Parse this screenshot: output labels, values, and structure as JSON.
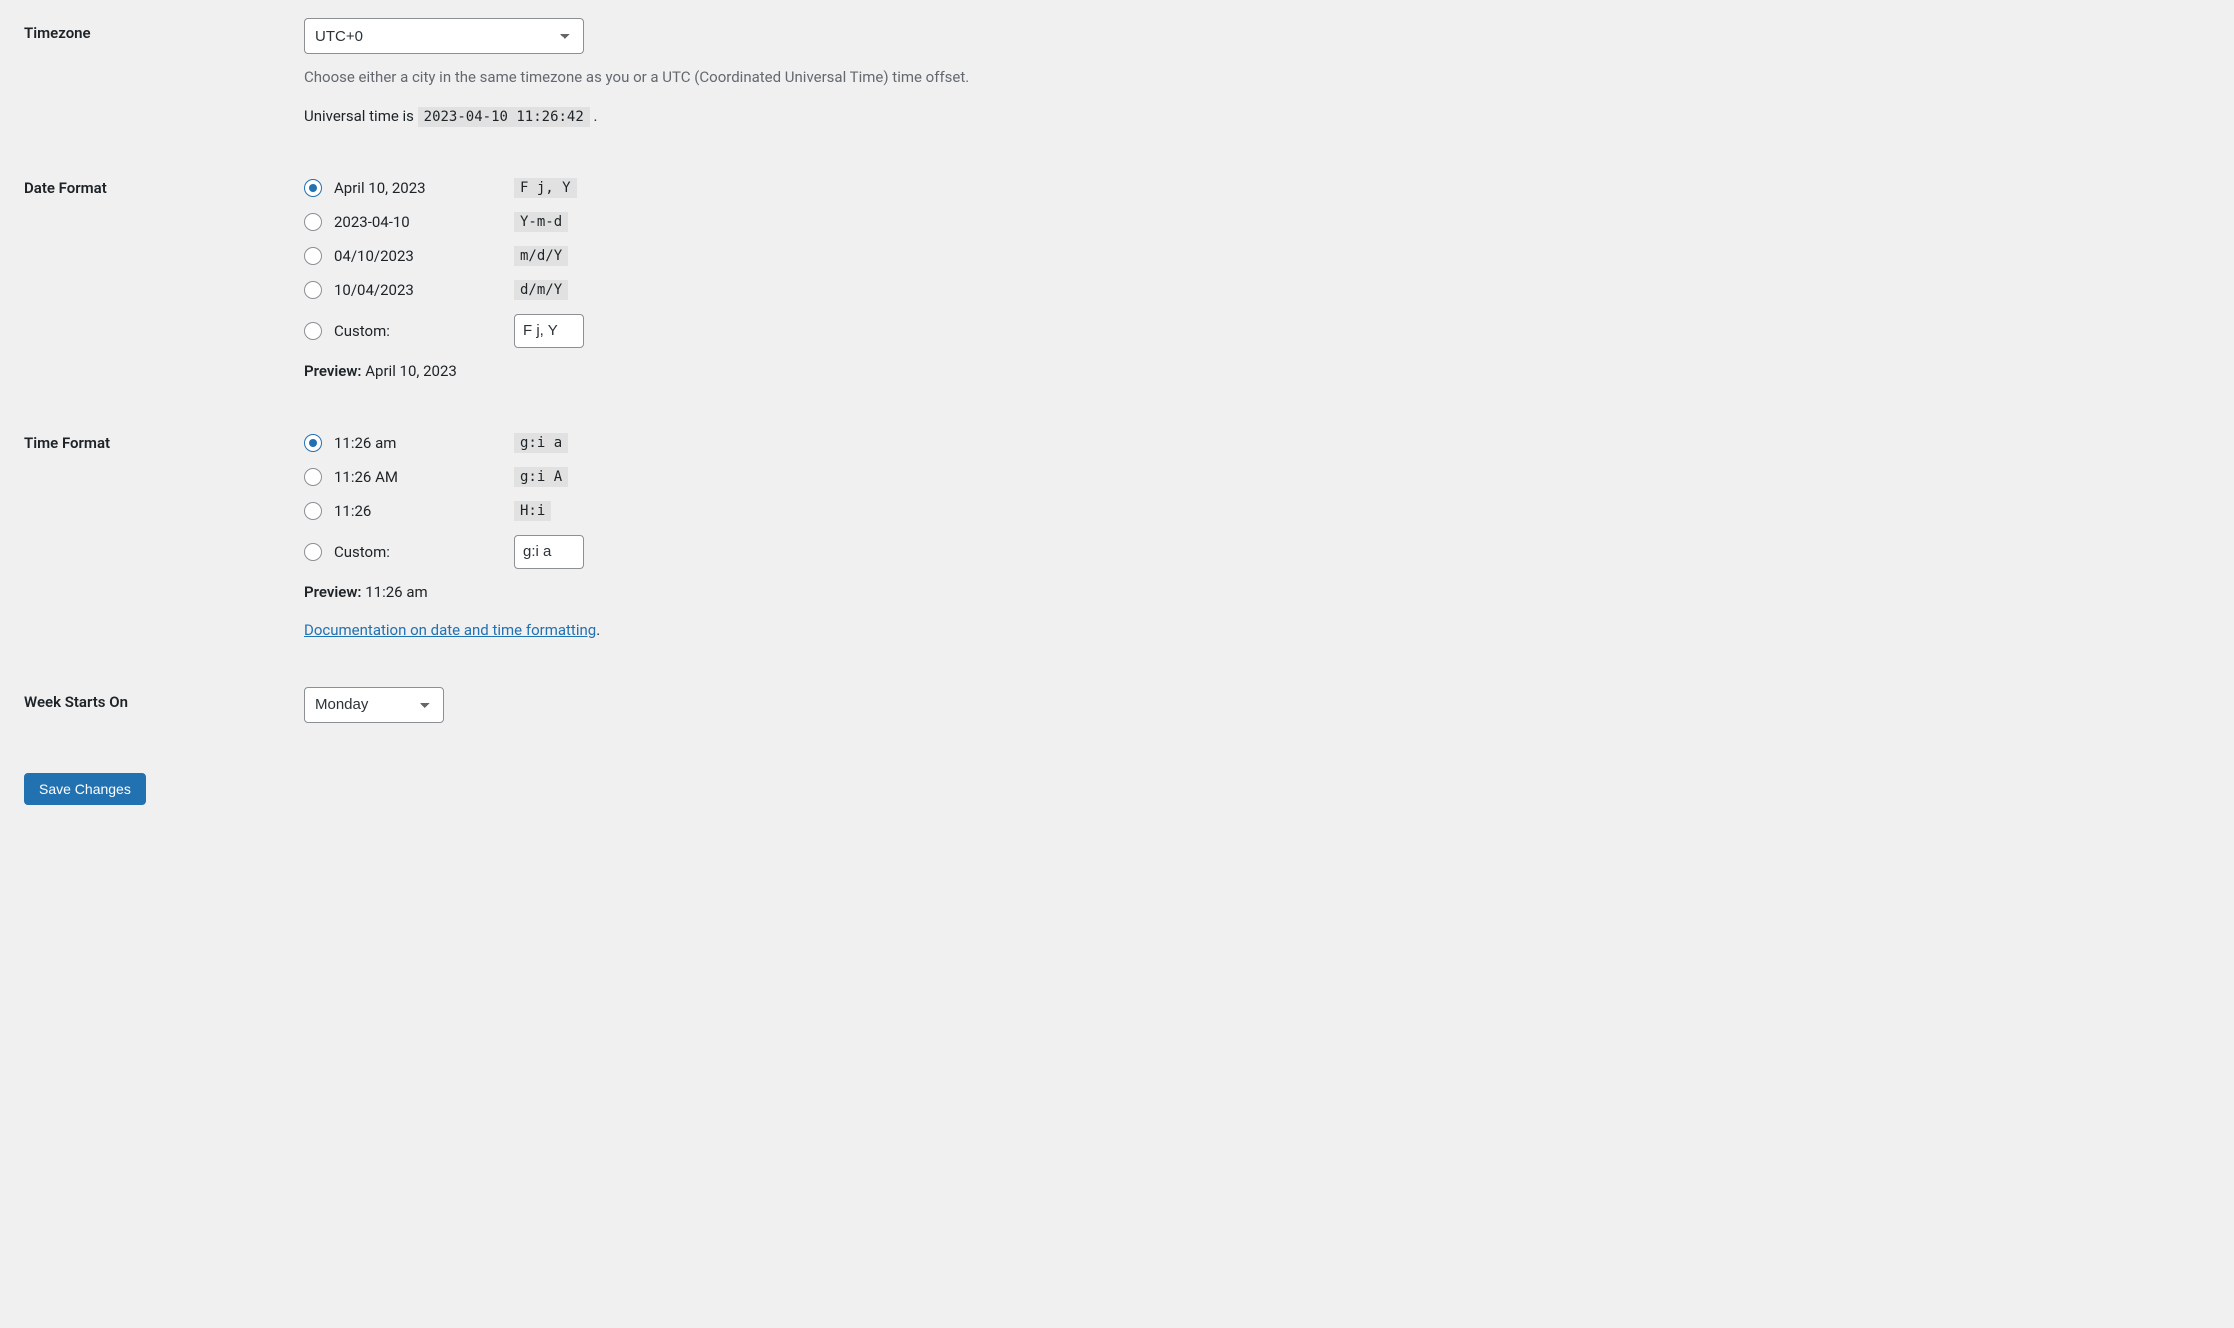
{
  "timezone": {
    "label": "Timezone",
    "value": "UTC+0",
    "desc": "Choose either a city in the same timezone as you or a UTC (Coordinated Universal Time) time offset.",
    "util_prefix": "Universal time is ",
    "util_time": "2023-04-10 11:26:42",
    "util_suffix": "."
  },
  "date_format": {
    "label": "Date Format",
    "options": [
      {
        "display": "April 10, 2023",
        "token": "F j, Y",
        "checked": true
      },
      {
        "display": "2023-04-10",
        "token": "Y-m-d",
        "checked": false
      },
      {
        "display": "04/10/2023",
        "token": "m/d/Y",
        "checked": false
      },
      {
        "display": "10/04/2023",
        "token": "d/m/Y",
        "checked": false
      }
    ],
    "custom_label": "Custom:",
    "custom_value": "F j, Y",
    "preview_label": "Preview:",
    "preview_value": "April 10, 2023"
  },
  "time_format": {
    "label": "Time Format",
    "options": [
      {
        "display": "11:26 am",
        "token": "g:i a",
        "checked": true
      },
      {
        "display": "11:26 AM",
        "token": "g:i A",
        "checked": false
      },
      {
        "display": "11:26",
        "token": "H:i",
        "checked": false
      }
    ],
    "custom_label": "Custom:",
    "custom_value": "g:i a",
    "preview_label": "Preview:",
    "preview_value": "11:26 am",
    "doc_link_text": "Documentation on date and time formatting",
    "doc_suffix": "."
  },
  "week_starts": {
    "label": "Week Starts On",
    "value": "Monday"
  },
  "save_button": "Save Changes"
}
